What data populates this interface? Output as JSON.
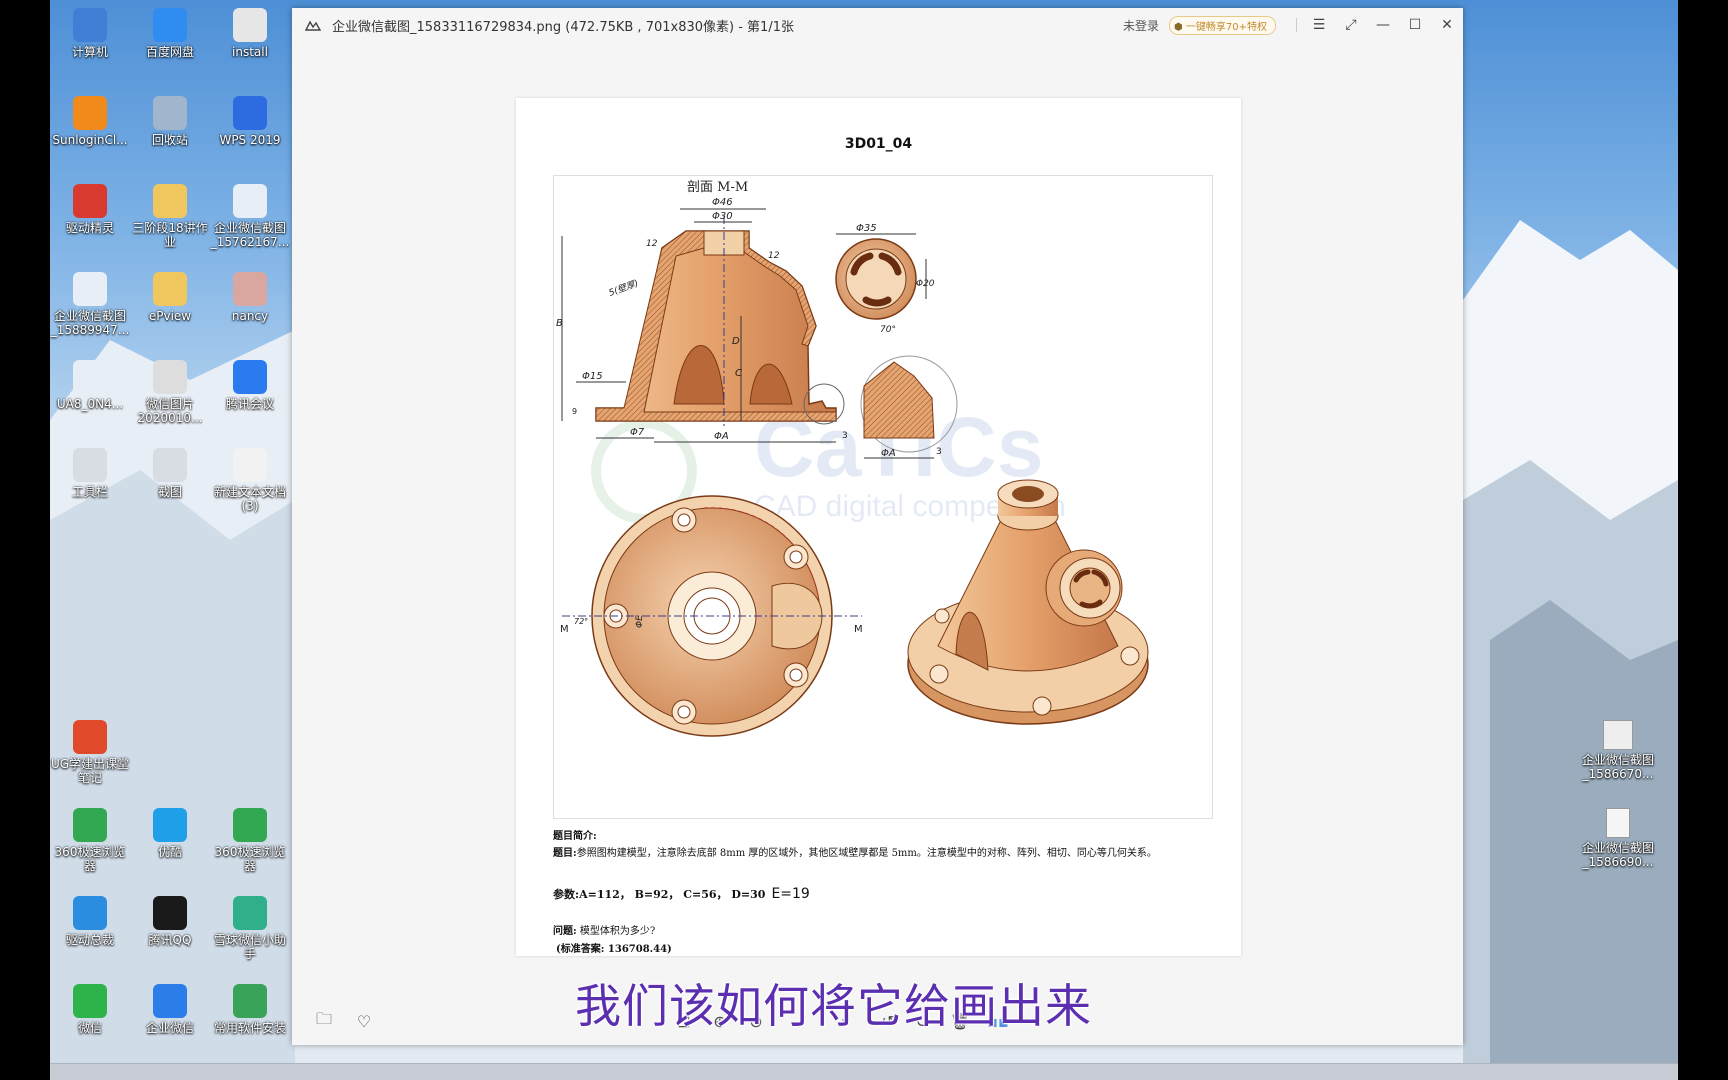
{
  "desktop": {
    "icons": [
      {
        "label": "计算机",
        "icon": "computer-icon",
        "color": "#3f7fd6"
      },
      {
        "label": "百度网盘",
        "icon": "baidu-netdisk-icon",
        "color": "#2f8cf0"
      },
      {
        "label": "install",
        "icon": "file-icon",
        "color": "#e6e6e6"
      },
      {
        "label": "SunloginCl...",
        "icon": "sunlogin-icon",
        "color": "#f08a1a"
      },
      {
        "label": "回收站",
        "icon": "recycle-bin-icon",
        "color": "#9fb6cc"
      },
      {
        "label": "WPS 2019",
        "icon": "wps-icon",
        "color": "#2d6be0"
      },
      {
        "label": "驱动精灵",
        "icon": "driver-genius-icon",
        "color": "#d93a2f"
      },
      {
        "label": "三阶段18讲作业",
        "icon": "folder-icon",
        "color": "#f0c75e"
      },
      {
        "label": "企业微信截图_15762167...",
        "icon": "image-file-icon",
        "color": "#e8eef5"
      },
      {
        "label": "企业微信截图_15889947...",
        "icon": "image-file-icon",
        "color": "#e8eef5"
      },
      {
        "label": "ePview",
        "icon": "folder-icon",
        "color": "#f0c75e"
      },
      {
        "label": "nancy",
        "icon": "photo-icon",
        "color": "#d9a6a0"
      },
      {
        "label": "UA8_0N4...",
        "icon": "image-file-icon",
        "color": "#e8eef5"
      },
      {
        "label": "微信图片 2020010...",
        "icon": "qr-image-icon",
        "color": "#dddddd"
      },
      {
        "label": "腾讯会议",
        "icon": "tencent-meeting-icon",
        "color": "#2a7bf0"
      },
      {
        "label": "工具栏",
        "icon": "toolbar-icon",
        "color": "#d8dde3"
      },
      {
        "label": "截图",
        "icon": "screenshot-icon",
        "color": "#d8dde3"
      },
      {
        "label": "新建文本文档 (3)",
        "icon": "text-file-icon",
        "color": "#f2f2f2"
      },
      {
        "label": "UG学建出课堂笔记",
        "icon": "ppt-file-icon",
        "color": "#e04a2a"
      },
      {
        "label": "360极速浏览器",
        "icon": "browser-360-icon",
        "color": "#33a852"
      },
      {
        "label": "优酷",
        "icon": "youku-icon",
        "color": "#1fa0e8"
      },
      {
        "label": "360极速浏览器",
        "icon": "browser-360-icon",
        "color": "#33a852"
      },
      {
        "label": "驱动总裁",
        "icon": "driver-icon",
        "color": "#2a8de0"
      },
      {
        "label": "腾讯QQ",
        "icon": "qq-icon",
        "color": "#1a1a1a"
      },
      {
        "label": "雪球微信小助手",
        "icon": "assistant-icon",
        "color": "#2fb08a"
      },
      {
        "label": "微信",
        "icon": "wechat-icon",
        "color": "#2db34a"
      },
      {
        "label": "企业微信",
        "icon": "wecom-icon",
        "color": "#2b7de9"
      },
      {
        "label": "常用软件安装",
        "icon": "software-install-icon",
        "color": "#3aa35a"
      }
    ],
    "right_icons": [
      {
        "label": "企业微信截图_1586670...",
        "icon": "qr-image-icon"
      },
      {
        "label": "企业微信截图_1586690...",
        "icon": "image-file-icon"
      }
    ]
  },
  "viewer": {
    "title": "企业微信截图_15833116729834.png (472.75KB , 701x830像素) - 第1/1张",
    "login_label": "未登录",
    "vip_label": "一键畅享70+特权",
    "accent": "#c28a2c"
  },
  "document": {
    "title": "3D01_04",
    "section_label": "剖面 M-M",
    "watermark_main": "CaTICs",
    "watermark_sub": "CAD digital competition",
    "dims": {
      "phi46": "Φ46",
      "phi30": "Φ30",
      "phi35": "Φ35",
      "phi20": "Φ20",
      "phi15": "Φ15",
      "phi7": "Φ7",
      "phiA": "ΦA",
      "phiA2": "ΦA",
      "phiE": "ΦE",
      "r12": "12",
      "r12b": "12",
      "s_label": "5(壁厚)",
      "angle70": "70°",
      "angle72": "72°",
      "b": "B",
      "c": "C",
      "d": "D",
      "n3": "3",
      "n3b": "3",
      "n9": "9",
      "m_left": "M",
      "m_right": "M"
    },
    "intro_heading": "题目简介:",
    "intro_label": "题目:",
    "intro_text": "参照图构建模型，注意除去底部 8mm 厚的区域外，其他区域壁厚都是 5mm。注意模型中的对称、阵列、相切、同心等几何关系。",
    "params_label": "参数:",
    "params_text": "A=112，  B=92，  C=56，  D=30",
    "params_e": "E=19",
    "question_label": "问题:",
    "question_text": "模型体积为多少?",
    "answer_text": "(标准答案: 136708.44)"
  },
  "subtitle": "我们该如何将它给画出来"
}
